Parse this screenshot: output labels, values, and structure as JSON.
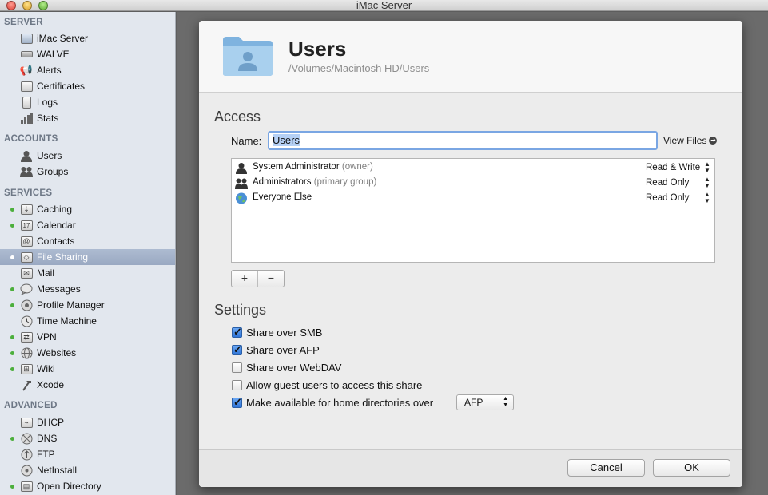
{
  "window": {
    "title": "iMac Server"
  },
  "sidebar": {
    "sections": {
      "server": "SERVER",
      "accounts": "ACCOUNTS",
      "services": "SERVICES",
      "advanced": "ADVANCED"
    },
    "server_items": [
      {
        "label": "iMac Server",
        "icon": "imac-icon"
      },
      {
        "label": "WALVE",
        "icon": "xserve-icon"
      },
      {
        "label": "Alerts",
        "icon": "alerts-icon"
      },
      {
        "label": "Certificates",
        "icon": "certificates-icon"
      },
      {
        "label": "Logs",
        "icon": "logs-icon"
      },
      {
        "label": "Stats",
        "icon": "stats-icon"
      }
    ],
    "account_items": [
      {
        "label": "Users",
        "icon": "user-icon"
      },
      {
        "label": "Groups",
        "icon": "groups-icon"
      }
    ],
    "service_items": [
      {
        "label": "Caching",
        "icon": "caching-icon",
        "active": true
      },
      {
        "label": "Calendar",
        "icon": "calendar-icon",
        "active": true
      },
      {
        "label": "Contacts",
        "icon": "contacts-icon",
        "active": false
      },
      {
        "label": "File Sharing",
        "icon": "file-sharing-icon",
        "active": true,
        "selected": true
      },
      {
        "label": "Mail",
        "icon": "mail-icon",
        "active": false
      },
      {
        "label": "Messages",
        "icon": "messages-icon",
        "active": true
      },
      {
        "label": "Profile Manager",
        "icon": "profile-manager-icon",
        "active": true
      },
      {
        "label": "Time Machine",
        "icon": "time-machine-icon",
        "active": false
      },
      {
        "label": "VPN",
        "icon": "vpn-icon",
        "active": true
      },
      {
        "label": "Websites",
        "icon": "websites-icon",
        "active": true
      },
      {
        "label": "Wiki",
        "icon": "wiki-icon",
        "active": true
      },
      {
        "label": "Xcode",
        "icon": "xcode-icon",
        "active": false
      }
    ],
    "advanced_items": [
      {
        "label": "DHCP",
        "icon": "dhcp-icon",
        "active": false
      },
      {
        "label": "DNS",
        "icon": "dns-icon",
        "active": true
      },
      {
        "label": "FTP",
        "icon": "ftp-icon",
        "active": false
      },
      {
        "label": "NetInstall",
        "icon": "netinstall-icon",
        "active": false
      },
      {
        "label": "Open Directory",
        "icon": "open-directory-icon",
        "active": true
      }
    ]
  },
  "sheet": {
    "title": "Users",
    "path": "/Volumes/Macintosh HD/Users",
    "access_heading": "Access",
    "name_label": "Name:",
    "name_value": "Users",
    "view_files": "View Files",
    "permissions": [
      {
        "name": "System Administrator",
        "role": "(owner)",
        "access": "Read & Write",
        "icon": "user-icon"
      },
      {
        "name": "Administrators",
        "role": "(primary group)",
        "access": "Read Only",
        "icon": "group-icon"
      },
      {
        "name": "Everyone Else",
        "role": "",
        "access": "Read Only",
        "icon": "globe-icon"
      }
    ],
    "add_label": "+",
    "remove_label": "−",
    "settings_heading": "Settings",
    "settings": [
      {
        "label": "Share over SMB",
        "checked": true
      },
      {
        "label": "Share over AFP",
        "checked": true
      },
      {
        "label": "Share over WebDAV",
        "checked": false
      },
      {
        "label": "Allow guest users to access this share",
        "checked": false
      },
      {
        "label": "Make available for home directories over",
        "checked": true
      }
    ],
    "home_protocol": "AFP",
    "cancel_label": "Cancel",
    "ok_label": "OK"
  },
  "colors": {
    "sidebar_bg": "#e2e7ee",
    "selection": "#9aa9c2",
    "status_dot": "#4caf3c",
    "input_focus": "#7aa6e3",
    "checkbox_blue": "#2f74d6"
  }
}
